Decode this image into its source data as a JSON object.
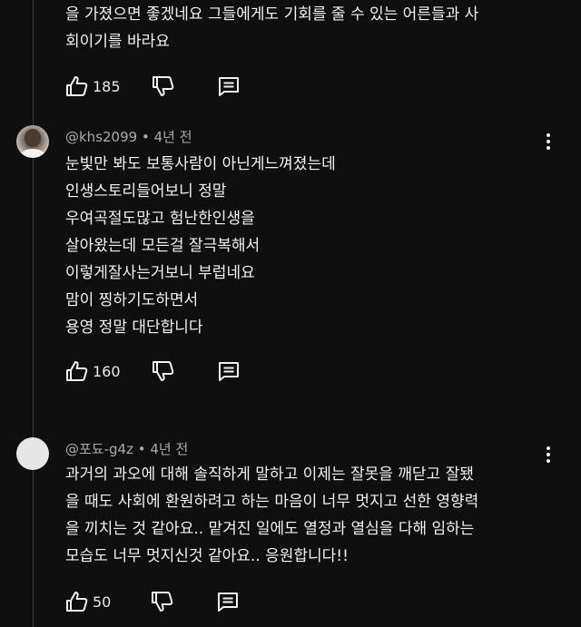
{
  "comment_prev": {
    "lines": [
      "을 가졌으면 좋겠네요 그들에게도 기회를 줄 수 있는 어른들과 사",
      "회이기를 바라요"
    ],
    "likes": "185"
  },
  "comment_khs": {
    "author": "@khs2099",
    "time": "4년 전",
    "lines": [
      "눈빛만 봐도 보통사람이  아닌게느껴졌는데",
      "인생스토리들어보니 정말",
      "우여곡절도많고 험난한인생을",
      "살아왔는데 모든걸  잘극복해서",
      "이렇게잘사는거보니 부럽네요",
      "맘이 찡하기도하면서",
      "용영 정말 대단합니다"
    ],
    "likes": "160"
  },
  "comment_podo": {
    "author": "@포됴-g4z",
    "time": "4년 전",
    "lines": [
      "과거의 과오에 대해 솔직하게 말하고 이제는 잘못을 깨닫고 잘됐",
      "을 때도 사회에 환원하려고 하는 마음이 너무 멋지고 선한 영향력",
      "을 끼치는 것 같아요.. 맡겨진 일에도 열정과 열심을 다해 임하는",
      "모습도 너무 멋지신것 같아요.. 응원합니다!!"
    ],
    "likes": "50"
  },
  "icons": {
    "like": "thumbs-up-icon",
    "dislike": "thumbs-down-icon",
    "reply": "reply-comment-icon",
    "menu": "more-vertical-icon"
  }
}
